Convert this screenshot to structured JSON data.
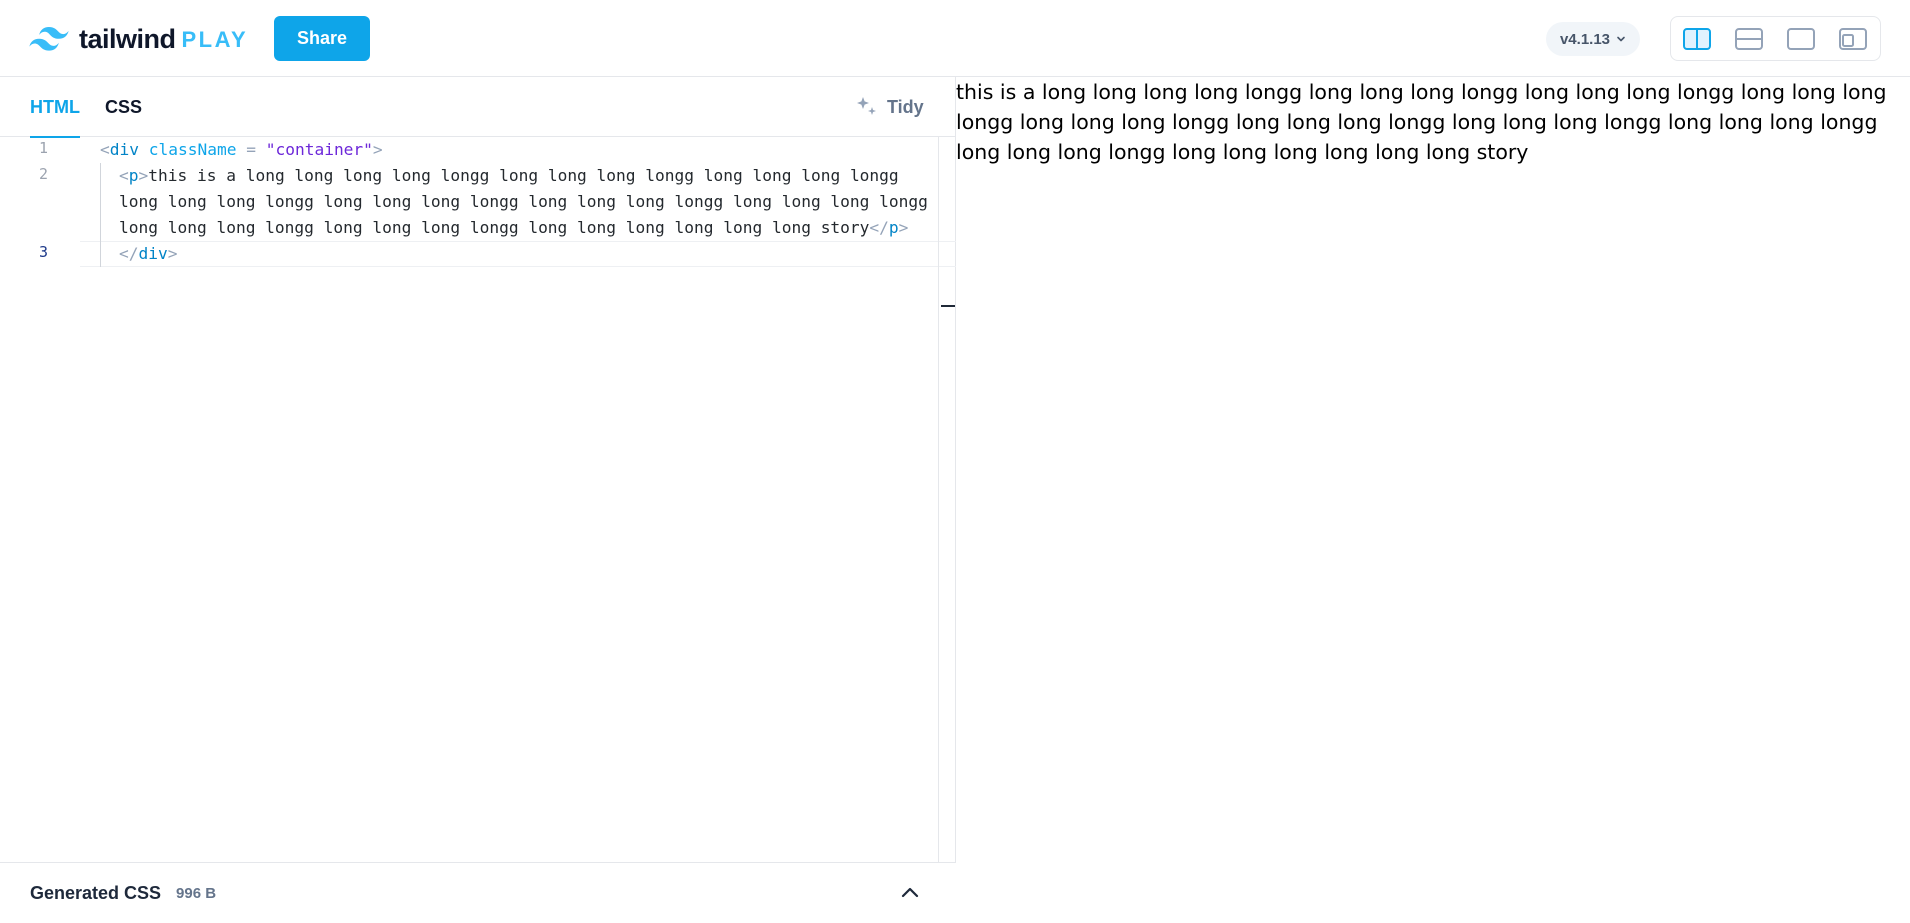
{
  "header": {
    "logo_word": "tailwind",
    "logo_play": "PLAY",
    "share_label": "Share",
    "version": "v4.1.13",
    "layout_options": [
      "split-vertical-icon",
      "split-horizontal-icon",
      "preview-only-icon",
      "responsive-icon"
    ],
    "active_layout": "split-vertical-icon"
  },
  "editor": {
    "tabs": [
      "HTML",
      "CSS"
    ],
    "active_tab": "HTML",
    "tidy_label": "Tidy",
    "line_numbers": [
      "1",
      "2",
      "3"
    ],
    "active_line": "3",
    "lines": {
      "l1": {
        "open": "<",
        "tag": "div",
        "sp": " ",
        "attr": "className",
        "eq": " = ",
        "str": "\"container\"",
        "close": ">"
      },
      "l2a": {
        "open": "<",
        "tag": "p",
        "close": ">",
        "text": "this is a long long long long longg long long long longg long long long longg"
      },
      "l2b": {
        "text": "long long long longg long long long longg long long long longg long long long longg"
      },
      "l2c": {
        "text": "long long long longg long long long longg long long long long long long story",
        "end_open": "</",
        "end_tag": "p",
        "end_close": ">"
      },
      "l3": {
        "open": "</",
        "tag": "div",
        "close": ">"
      }
    }
  },
  "generated_css": {
    "title": "Generated CSS",
    "size": "996 B"
  },
  "preview": {
    "text": "this is a long long long long longg long long long longg long long long longg long long long longg long long long longg long long long longg long long long longg long long long longg long long long longg long long long long long long story"
  },
  "colors": {
    "accent": "#0ea5e9",
    "logo_play": "#38bdf8",
    "string": "#6d28d9",
    "tag": "#0284c7"
  }
}
